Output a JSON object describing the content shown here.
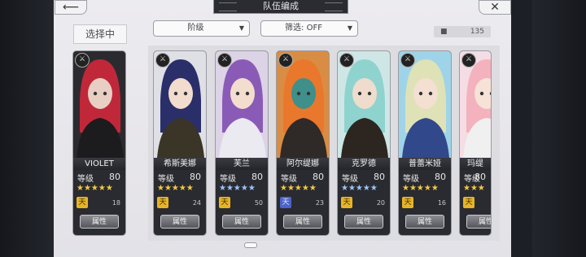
{
  "title": "队伍编成",
  "back_icon": "back-arrow-icon",
  "close_icon": "close-x-icon",
  "selecting_label": "选择中",
  "filters": {
    "sort_label": "阶级",
    "filter_label": "筛选: OFF"
  },
  "roster_count": "135",
  "level_label": "等级",
  "attr_label": "属性",
  "colors": {
    "gold_star": "#f3c940",
    "blue_star": "#9ac4ff",
    "rank_gold": "#e6b427",
    "rank_blue": "#4c63c9"
  },
  "characters": [
    {
      "name": "VIOLET",
      "level": "80",
      "stars": "★★★★★",
      "star_color": "gold",
      "rank_icon": "rank-gold-icon",
      "rank_color": "gold",
      "stack": "18",
      "class_icon": "sword-class-icon",
      "selected": true
    },
    {
      "name": "希斯美娜",
      "level": "80",
      "stars": "★★★★★",
      "star_color": "gold",
      "rank_icon": "rank-gold-icon",
      "rank_color": "gold",
      "stack": "24",
      "class_icon": "bow-class-icon"
    },
    {
      "name": "芙兰",
      "level": "80",
      "stars": "★★★★★",
      "star_color": "blue",
      "rank_icon": "rank-gold-icon",
      "rank_color": "gold",
      "stack": "50",
      "class_icon": "bow-class-icon"
    },
    {
      "name": "阿尔缇娜",
      "level": "80",
      "stars": "★★★★★",
      "star_color": "gold",
      "rank_icon": "rank-blue-icon",
      "rank_color": "blue",
      "stack": "23",
      "class_icon": "sword-class-icon"
    },
    {
      "name": "克罗德",
      "level": "80",
      "stars": "★★★★★",
      "star_color": "blue",
      "rank_icon": "rank-gold-icon",
      "rank_color": "gold",
      "stack": "20",
      "class_icon": "bow-class-icon"
    },
    {
      "name": "普蕾米娅",
      "level": "80",
      "stars": "★★★★★",
      "star_color": "gold",
      "rank_icon": "rank-gold-icon",
      "rank_color": "gold",
      "stack": "16",
      "class_icon": "sword-class-icon"
    },
    {
      "name": "玛缇",
      "level": "80",
      "stars": "★★★",
      "star_color": "gold",
      "rank_icon": "rank-gold-icon",
      "rank_color": "gold",
      "stack": "",
      "class_icon": "sword-class-icon"
    }
  ]
}
